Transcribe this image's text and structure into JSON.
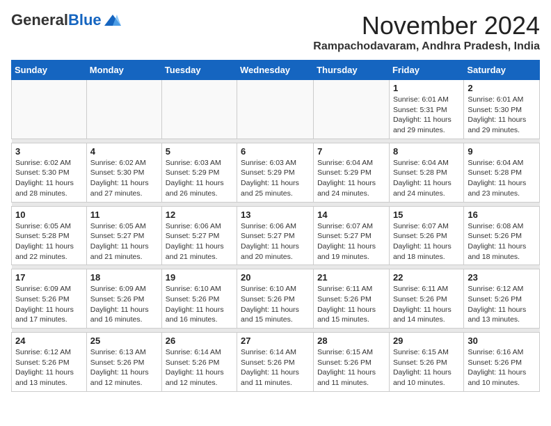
{
  "header": {
    "logo": {
      "general": "General",
      "blue": "Blue"
    },
    "title": "November 2024",
    "location": "Rampachodavaram, Andhra Pradesh, India"
  },
  "weekdays": [
    "Sunday",
    "Monday",
    "Tuesday",
    "Wednesday",
    "Thursday",
    "Friday",
    "Saturday"
  ],
  "weeks": [
    [
      {
        "day": "",
        "info": ""
      },
      {
        "day": "",
        "info": ""
      },
      {
        "day": "",
        "info": ""
      },
      {
        "day": "",
        "info": ""
      },
      {
        "day": "",
        "info": ""
      },
      {
        "day": "1",
        "info": "Sunrise: 6:01 AM\nSunset: 5:31 PM\nDaylight: 11 hours and 29 minutes."
      },
      {
        "day": "2",
        "info": "Sunrise: 6:01 AM\nSunset: 5:30 PM\nDaylight: 11 hours and 29 minutes."
      }
    ],
    [
      {
        "day": "3",
        "info": "Sunrise: 6:02 AM\nSunset: 5:30 PM\nDaylight: 11 hours and 28 minutes."
      },
      {
        "day": "4",
        "info": "Sunrise: 6:02 AM\nSunset: 5:30 PM\nDaylight: 11 hours and 27 minutes."
      },
      {
        "day": "5",
        "info": "Sunrise: 6:03 AM\nSunset: 5:29 PM\nDaylight: 11 hours and 26 minutes."
      },
      {
        "day": "6",
        "info": "Sunrise: 6:03 AM\nSunset: 5:29 PM\nDaylight: 11 hours and 25 minutes."
      },
      {
        "day": "7",
        "info": "Sunrise: 6:04 AM\nSunset: 5:29 PM\nDaylight: 11 hours and 24 minutes."
      },
      {
        "day": "8",
        "info": "Sunrise: 6:04 AM\nSunset: 5:28 PM\nDaylight: 11 hours and 24 minutes."
      },
      {
        "day": "9",
        "info": "Sunrise: 6:04 AM\nSunset: 5:28 PM\nDaylight: 11 hours and 23 minutes."
      }
    ],
    [
      {
        "day": "10",
        "info": "Sunrise: 6:05 AM\nSunset: 5:28 PM\nDaylight: 11 hours and 22 minutes."
      },
      {
        "day": "11",
        "info": "Sunrise: 6:05 AM\nSunset: 5:27 PM\nDaylight: 11 hours and 21 minutes."
      },
      {
        "day": "12",
        "info": "Sunrise: 6:06 AM\nSunset: 5:27 PM\nDaylight: 11 hours and 21 minutes."
      },
      {
        "day": "13",
        "info": "Sunrise: 6:06 AM\nSunset: 5:27 PM\nDaylight: 11 hours and 20 minutes."
      },
      {
        "day": "14",
        "info": "Sunrise: 6:07 AM\nSunset: 5:27 PM\nDaylight: 11 hours and 19 minutes."
      },
      {
        "day": "15",
        "info": "Sunrise: 6:07 AM\nSunset: 5:26 PM\nDaylight: 11 hours and 18 minutes."
      },
      {
        "day": "16",
        "info": "Sunrise: 6:08 AM\nSunset: 5:26 PM\nDaylight: 11 hours and 18 minutes."
      }
    ],
    [
      {
        "day": "17",
        "info": "Sunrise: 6:09 AM\nSunset: 5:26 PM\nDaylight: 11 hours and 17 minutes."
      },
      {
        "day": "18",
        "info": "Sunrise: 6:09 AM\nSunset: 5:26 PM\nDaylight: 11 hours and 16 minutes."
      },
      {
        "day": "19",
        "info": "Sunrise: 6:10 AM\nSunset: 5:26 PM\nDaylight: 11 hours and 16 minutes."
      },
      {
        "day": "20",
        "info": "Sunrise: 6:10 AM\nSunset: 5:26 PM\nDaylight: 11 hours and 15 minutes."
      },
      {
        "day": "21",
        "info": "Sunrise: 6:11 AM\nSunset: 5:26 PM\nDaylight: 11 hours and 15 minutes."
      },
      {
        "day": "22",
        "info": "Sunrise: 6:11 AM\nSunset: 5:26 PM\nDaylight: 11 hours and 14 minutes."
      },
      {
        "day": "23",
        "info": "Sunrise: 6:12 AM\nSunset: 5:26 PM\nDaylight: 11 hours and 13 minutes."
      }
    ],
    [
      {
        "day": "24",
        "info": "Sunrise: 6:12 AM\nSunset: 5:26 PM\nDaylight: 11 hours and 13 minutes."
      },
      {
        "day": "25",
        "info": "Sunrise: 6:13 AM\nSunset: 5:26 PM\nDaylight: 11 hours and 12 minutes."
      },
      {
        "day": "26",
        "info": "Sunrise: 6:14 AM\nSunset: 5:26 PM\nDaylight: 11 hours and 12 minutes."
      },
      {
        "day": "27",
        "info": "Sunrise: 6:14 AM\nSunset: 5:26 PM\nDaylight: 11 hours and 11 minutes."
      },
      {
        "day": "28",
        "info": "Sunrise: 6:15 AM\nSunset: 5:26 PM\nDaylight: 11 hours and 11 minutes."
      },
      {
        "day": "29",
        "info": "Sunrise: 6:15 AM\nSunset: 5:26 PM\nDaylight: 11 hours and 10 minutes."
      },
      {
        "day": "30",
        "info": "Sunrise: 6:16 AM\nSunset: 5:26 PM\nDaylight: 11 hours and 10 minutes."
      }
    ]
  ]
}
